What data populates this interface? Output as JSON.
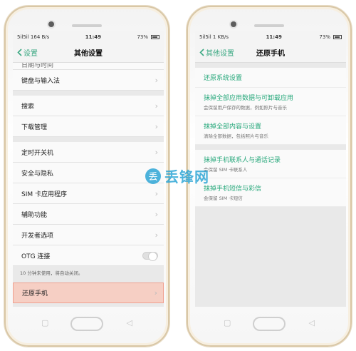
{
  "left": {
    "status": {
      "signal": "5il5il",
      "speed": "164 B/s",
      "time": "11:49",
      "battery": "73%"
    },
    "title": "其他设置",
    "back_label": "设置",
    "rows": {
      "cut_top": "日期与时间",
      "keyboard": "键盘与输入法",
      "search": "搜索",
      "downloads": "下载管理",
      "timer": "定时开关机",
      "security": "安全与隐私",
      "sim": "SIM 卡应用程序",
      "accessibility": "辅助功能",
      "developer": "开发者选项",
      "otg": "OTG 连接",
      "reset": "还原手机"
    },
    "otg_note": "10 分钟未使用，将自动关闭。",
    "otg_toggle_on": false
  },
  "right": {
    "status": {
      "signal": "5il5il",
      "speed": "1 KB/s",
      "time": "11:49",
      "battery": "73%"
    },
    "title": "还原手机",
    "back_label": "其他设置",
    "items": [
      {
        "title": "还原系统设置",
        "sub": ""
      },
      {
        "title": "抹掉全部应用数据与可卸载应用",
        "sub": "会保留用户保存的数据，例如照片与音乐"
      },
      {
        "title": "抹掉全部内容与设置",
        "sub": "清除全部数据，包括照片与音乐"
      },
      {
        "title": "抹掉手机联系人与通话记录",
        "sub": "会保留 SIM 卡联系人"
      },
      {
        "title": "抹掉手机短信与彩信",
        "sub": "会保留 SIM 卡短信"
      }
    ]
  },
  "watermark": {
    "glyph": "丢",
    "text": "丢锋网"
  },
  "colors": {
    "accent": "#27a87b",
    "highlight": "#f6cfc4",
    "watermark": "#2ea6d6"
  }
}
